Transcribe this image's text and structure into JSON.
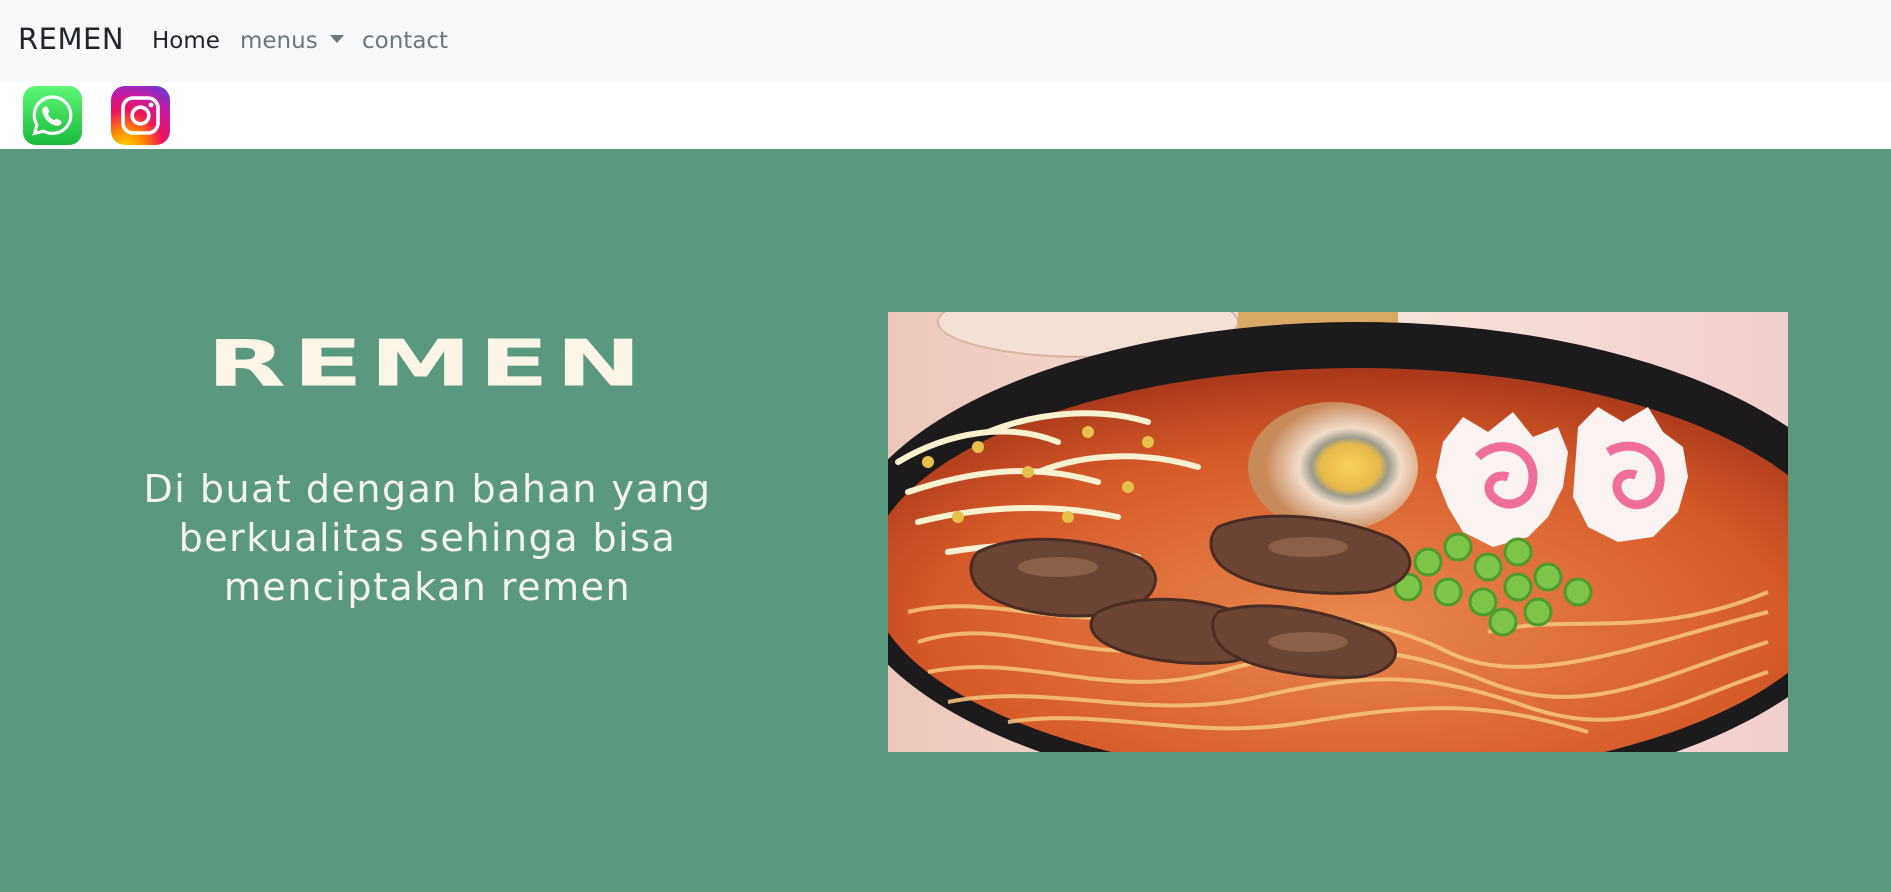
{
  "navbar": {
    "brand": "REMEN",
    "links": {
      "home": "Home",
      "menus": "menus",
      "contact": "contact"
    }
  },
  "social": {
    "icons": [
      "whatsapp-icon",
      "instagram-icon"
    ]
  },
  "hero": {
    "title": "REMEN",
    "description": "Di buat dengan bahan yang berkualitas sehinga bisa menciptakan remen",
    "image": "ramen-bowl-photo"
  },
  "colors": {
    "navbar_bg": "#f8f9fa",
    "hero_bg": "#5a987f",
    "title_text": "#fbf5e8",
    "whatsapp": "#25d366"
  }
}
